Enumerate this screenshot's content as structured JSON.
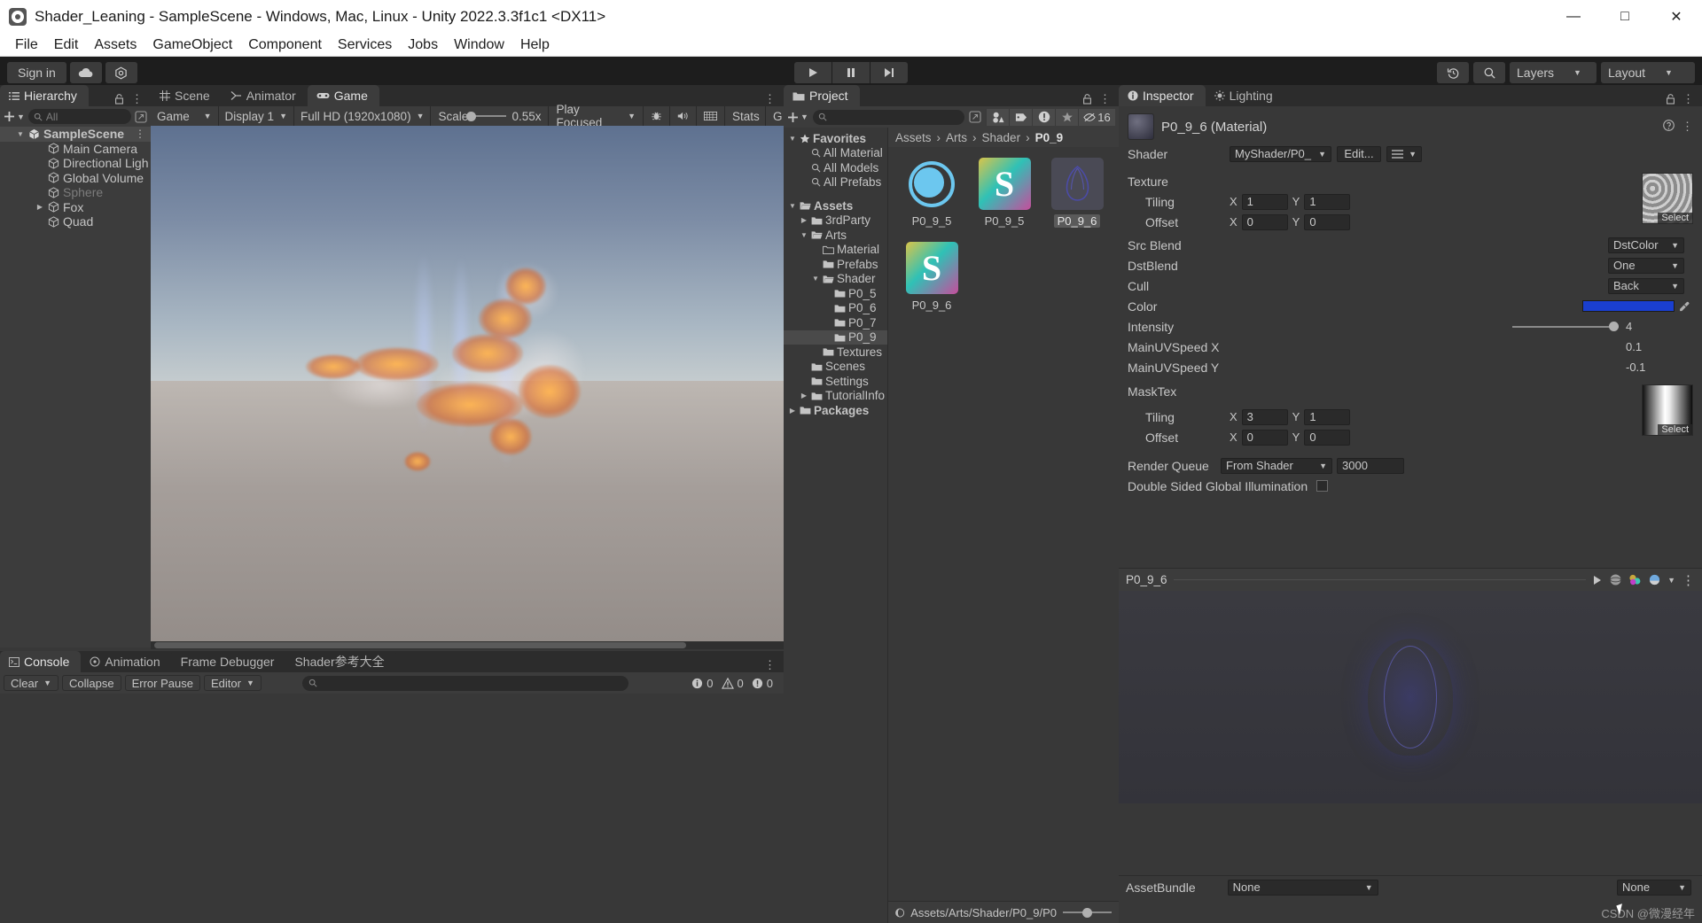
{
  "window": {
    "title": "Shader_Leaning - SampleScene - Windows, Mac, Linux - Unity 2022.3.3f1c1 <DX11>",
    "minimize": "—",
    "maximize": "□",
    "close": "✕"
  },
  "menu": [
    "File",
    "Edit",
    "Assets",
    "GameObject",
    "Component",
    "Services",
    "Jobs",
    "Window",
    "Help"
  ],
  "toolbar": {
    "sign_in": "Sign in",
    "cloud_icon": "cloud-icon",
    "settings_icon": "unity-services-icon",
    "play": "▶",
    "pause": "▐▐",
    "step": "⏭",
    "undo_history_icon": "undo-history-icon",
    "search_icon": "search-icon",
    "layers": "Layers",
    "layout": "Layout"
  },
  "hierarchy": {
    "tab": "Hierarchy",
    "search_placeholder": "All",
    "items": [
      {
        "label": "SampleScene",
        "depth": 0,
        "expanded": true,
        "selected": true,
        "dim": false,
        "kind": "scene"
      },
      {
        "label": "Main Camera",
        "depth": 1,
        "expanded": null,
        "selected": false,
        "dim": false,
        "kind": "go"
      },
      {
        "label": "Directional Ligh",
        "depth": 1,
        "expanded": null,
        "selected": false,
        "dim": false,
        "kind": "go"
      },
      {
        "label": "Global Volume",
        "depth": 1,
        "expanded": null,
        "selected": false,
        "dim": false,
        "kind": "go"
      },
      {
        "label": "Sphere",
        "depth": 1,
        "expanded": null,
        "selected": false,
        "dim": true,
        "kind": "go"
      },
      {
        "label": "Fox",
        "depth": 1,
        "expanded": false,
        "selected": false,
        "dim": false,
        "kind": "go"
      },
      {
        "label": "Quad",
        "depth": 1,
        "expanded": null,
        "selected": false,
        "dim": false,
        "kind": "go"
      }
    ]
  },
  "gameview": {
    "tabs": [
      {
        "label": "Scene",
        "icon": "grid-icon",
        "active": false
      },
      {
        "label": "Animator",
        "icon": "animator-icon",
        "active": false
      },
      {
        "label": "Game",
        "icon": "gamepad-icon",
        "active": true
      }
    ],
    "mode": "Game",
    "display": "Display 1",
    "resolution": "Full HD (1920x1080)",
    "scale_label": "Scale",
    "scale_value": "0.55x",
    "play_mode": "Play Focused",
    "mute_icon": "mute-audio-icon",
    "gizmos_icon": "gizmos-icon",
    "stats": "Stats",
    "gizmos_label": "G"
  },
  "console": {
    "tabs": [
      {
        "label": "Console",
        "icon": "console-icon",
        "active": true
      },
      {
        "label": "Animation",
        "icon": "animation-icon",
        "active": false
      },
      {
        "label": "Frame Debugger",
        "icon": "",
        "active": false
      },
      {
        "label": "Shader参考大全",
        "icon": "",
        "active": false
      }
    ],
    "clear": "Clear",
    "collapse": "Collapse",
    "error_pause": "Error Pause",
    "editor": "Editor",
    "search_placeholder": "",
    "counts": {
      "info": "0",
      "warning": "0",
      "error": "0"
    }
  },
  "project": {
    "tab": "Project",
    "search_placeholder": "",
    "hidden_count": "16",
    "icon_buttons": [
      "material-filter-icon",
      "label-filter-icon",
      "warning-filter-icon",
      "favorite-icon"
    ],
    "tree": [
      {
        "label": "Favorites",
        "depth": 0,
        "icon": "star-icon",
        "expanded": true,
        "bold": true
      },
      {
        "label": "All Material",
        "depth": 1,
        "icon": "search-icon",
        "expanded": null,
        "bold": false
      },
      {
        "label": "All Models",
        "depth": 1,
        "icon": "search-icon",
        "expanded": null,
        "bold": false
      },
      {
        "label": "All Prefabs",
        "depth": 1,
        "icon": "search-icon",
        "expanded": null,
        "bold": false
      },
      {
        "label": "",
        "depth": 0,
        "icon": "",
        "expanded": null,
        "bold": false
      },
      {
        "label": "Assets",
        "depth": 0,
        "icon": "folder-open-icon",
        "expanded": true,
        "bold": true
      },
      {
        "label": "3rdParty",
        "depth": 1,
        "icon": "folder-icon",
        "expanded": false,
        "bold": false
      },
      {
        "label": "Arts",
        "depth": 1,
        "icon": "folder-open-icon",
        "expanded": true,
        "bold": false
      },
      {
        "label": "Material",
        "depth": 2,
        "icon": "folder-empty-icon",
        "expanded": null,
        "bold": false
      },
      {
        "label": "Prefabs",
        "depth": 2,
        "icon": "folder-icon",
        "expanded": null,
        "bold": false
      },
      {
        "label": "Shader",
        "depth": 2,
        "icon": "folder-open-icon",
        "expanded": true,
        "bold": false
      },
      {
        "label": "P0_5",
        "depth": 3,
        "icon": "folder-icon",
        "expanded": null,
        "bold": false
      },
      {
        "label": "P0_6",
        "depth": 3,
        "icon": "folder-icon",
        "expanded": null,
        "bold": false
      },
      {
        "label": "P0_7",
        "depth": 3,
        "icon": "folder-icon",
        "expanded": null,
        "bold": false
      },
      {
        "label": "P0_9",
        "depth": 3,
        "icon": "folder-icon",
        "expanded": null,
        "bold": false,
        "selected": true
      },
      {
        "label": "Textures",
        "depth": 2,
        "icon": "folder-icon",
        "expanded": null,
        "bold": false
      },
      {
        "label": "Scenes",
        "depth": 1,
        "icon": "folder-icon",
        "expanded": null,
        "bold": false
      },
      {
        "label": "Settings",
        "depth": 1,
        "icon": "folder-icon",
        "expanded": null,
        "bold": false
      },
      {
        "label": "TutorialInfo",
        "depth": 1,
        "icon": "folder-icon",
        "expanded": false,
        "bold": false
      },
      {
        "label": "Packages",
        "depth": 0,
        "icon": "folder-icon",
        "expanded": false,
        "bold": true
      }
    ],
    "breadcrumb": [
      "Assets",
      "Arts",
      "Shader",
      "P0_9"
    ],
    "assets": [
      {
        "label": "P0_9_5",
        "kind": "material",
        "selected": false
      },
      {
        "label": "P0_9_5",
        "kind": "shader",
        "selected": false
      },
      {
        "label": "P0_9_6",
        "kind": "material-preview",
        "selected": true
      },
      {
        "label": "P0_9_6",
        "kind": "shader",
        "selected": false
      }
    ],
    "status_path": "Assets/Arts/Shader/P0_9/P0"
  },
  "inspector": {
    "tabs": [
      {
        "label": "Inspector",
        "icon": "inspector-icon",
        "active": true
      },
      {
        "label": "Lighting",
        "icon": "lighting-icon",
        "active": false
      }
    ],
    "asset_title": "P0_9_6 (Material)",
    "shader_label": "Shader",
    "shader_value": "MyShader/P0_",
    "edit_button": "Edit...",
    "properties": {
      "texture_label": "Texture",
      "tiling_label": "Tiling",
      "offset_label": "Offset",
      "tex_tiling_x": "1",
      "tex_tiling_y": "1",
      "tex_offset_x": "0",
      "tex_offset_y": "0",
      "select_label": "Select",
      "src_blend_label": "Src Blend",
      "src_blend_value": "DstColor",
      "dst_blend_label": "DstBlend",
      "dst_blend_value": "One",
      "cull_label": "Cull",
      "cull_value": "Back",
      "color_label": "Color",
      "color_value": "#1A3FD0",
      "intensity_label": "Intensity",
      "intensity_value": "4",
      "uvspeed_x_label": "MainUVSpeed X",
      "uvspeed_x_value": "0.1",
      "uvspeed_y_label": "MainUVSpeed Y",
      "uvspeed_y_value": "-0.1",
      "masktex_label": "MaskTex",
      "mask_tiling_x": "3",
      "mask_tiling_y": "1",
      "mask_offset_x": "0",
      "mask_offset_y": "0",
      "render_queue_label": "Render Queue",
      "render_queue_mode": "From Shader",
      "render_queue_value": "3000",
      "double_sided_label": "Double Sided Global Illumination"
    },
    "preview": {
      "name": "P0_9_6",
      "play_icon": "play-icon",
      "sphere_icon": "sphere-icon",
      "lighting_icon": "lighting-icon",
      "render_icon": "render-icon",
      "menu_icon": "more-icon"
    },
    "assetbundle_label": "AssetBundle",
    "assetbundle_value": "None",
    "assetbundle_variant": "None"
  },
  "watermark": "CSDN @微漫经年"
}
